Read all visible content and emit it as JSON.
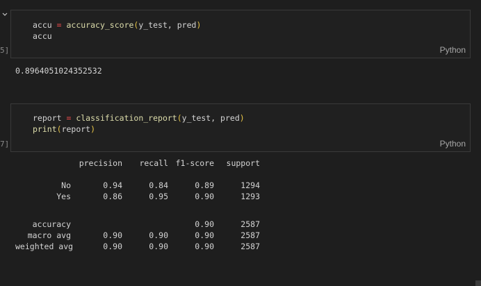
{
  "cells": [
    {
      "exec_count": "5]",
      "code_lines": [
        [
          {
            "t": "accu",
            "k": "var"
          },
          {
            "t": " = ",
            "k": "op"
          },
          {
            "t": "accuracy_score",
            "k": "fn"
          },
          {
            "t": "(",
            "k": "paren"
          },
          {
            "t": "y_test, pred",
            "k": "var"
          },
          {
            "t": ")",
            "k": "paren"
          }
        ],
        [
          {
            "t": "accu",
            "k": "var"
          }
        ]
      ],
      "language": "Python",
      "output": "0.8964051024352532"
    },
    {
      "exec_count": "7]",
      "code_lines": [
        [
          {
            "t": "report",
            "k": "var"
          },
          {
            "t": " = ",
            "k": "op"
          },
          {
            "t": "classification_report",
            "k": "fn"
          },
          {
            "t": "(",
            "k": "paren"
          },
          {
            "t": "y_test, pred",
            "k": "var"
          },
          {
            "t": ")",
            "k": "paren"
          }
        ],
        [
          {
            "t": "print",
            "k": "fn"
          },
          {
            "t": "(",
            "k": "paren"
          },
          {
            "t": "report",
            "k": "var"
          },
          {
            "t": ")",
            "k": "paren"
          }
        ]
      ],
      "language": "Python"
    }
  ],
  "report": {
    "headers": [
      "",
      "precision",
      "recall",
      "f1-score",
      "support"
    ],
    "rows": [
      [
        "No",
        "0.94",
        "0.84",
        "0.89",
        "1294"
      ],
      [
        "Yes",
        "0.86",
        "0.95",
        "0.90",
        "1293"
      ],
      [
        "",
        "",
        "",
        "",
        ""
      ],
      [
        "accuracy",
        "",
        "",
        "0.90",
        "2587"
      ],
      [
        "macro avg",
        "0.90",
        "0.90",
        "0.90",
        "2587"
      ],
      [
        "weighted avg",
        "0.90",
        "0.90",
        "0.90",
        "2587"
      ]
    ]
  },
  "colors": {
    "background": "#1e1e1e",
    "cell_background": "#202020",
    "operator": "#f14c4c",
    "function": "#dcdcaa",
    "paren": "#e8c547",
    "text": "#d4d4d4"
  },
  "icons": {
    "collapse": "chevron-down-icon"
  }
}
